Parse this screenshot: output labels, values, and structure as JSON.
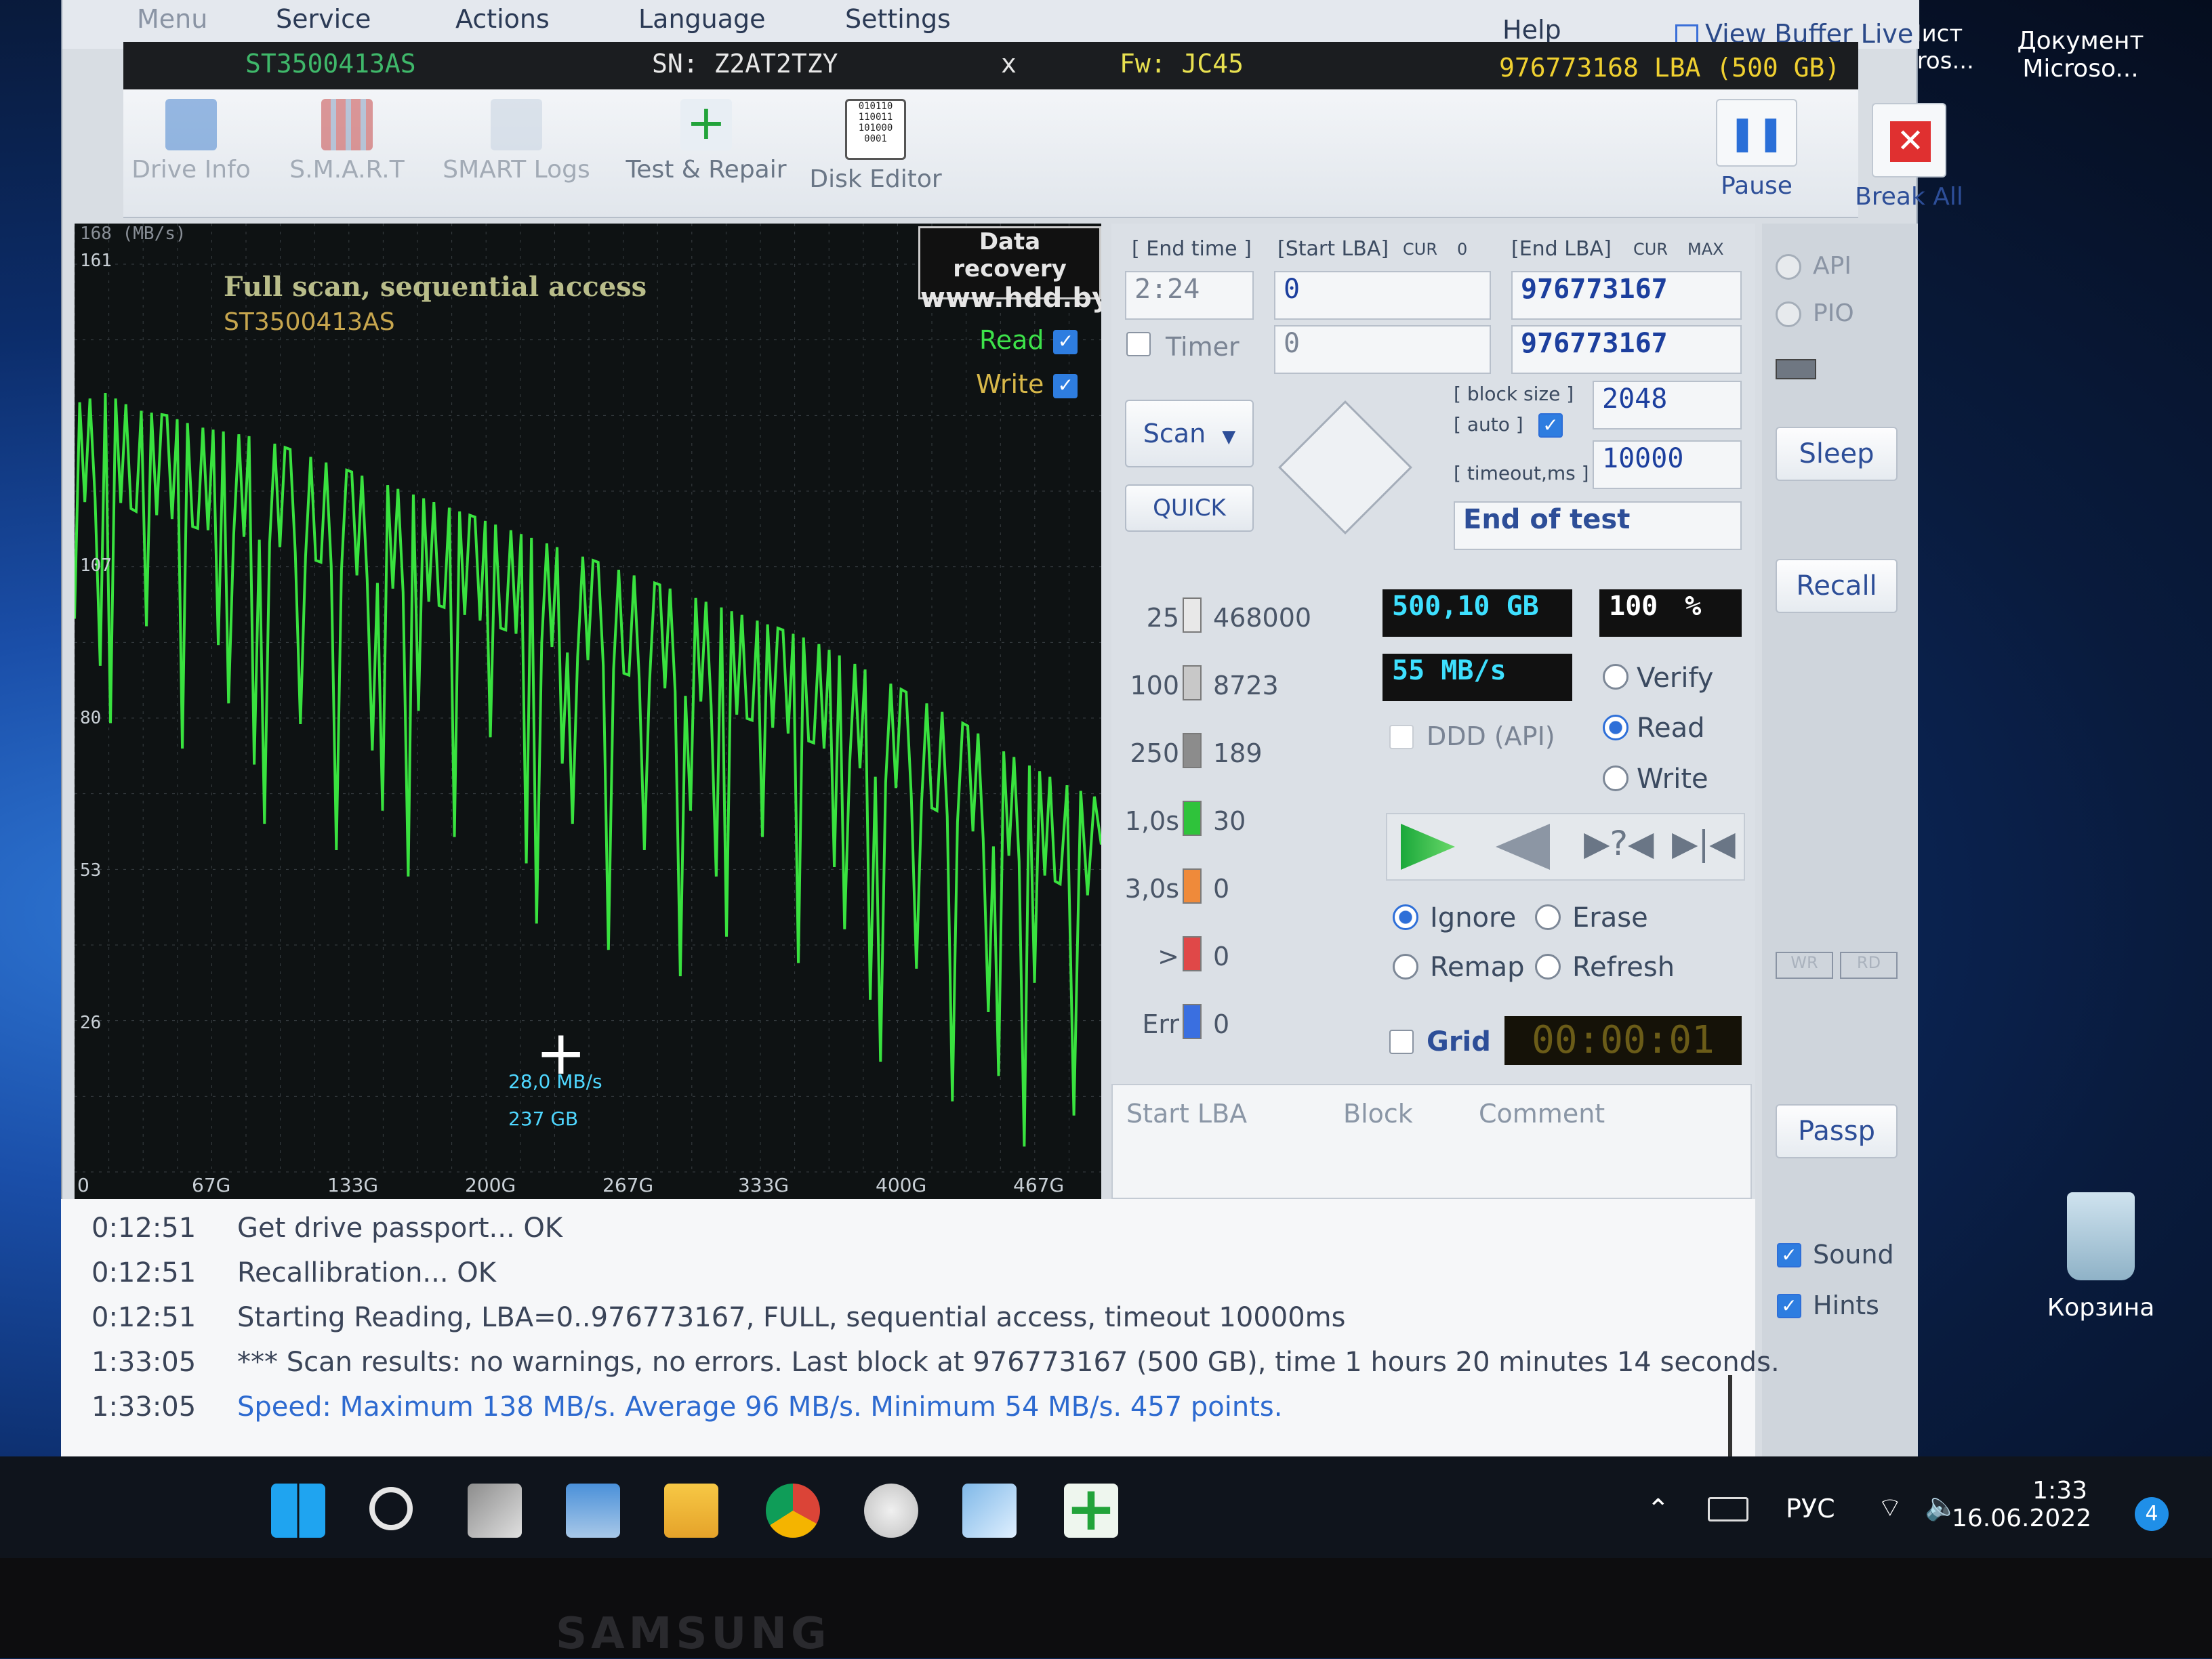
{
  "menu": {
    "items": [
      "Menu",
      "Service",
      "Actions",
      "Language",
      "Settings",
      "Help"
    ],
    "view_buffer": "View Buffer Live"
  },
  "drive": {
    "model": "ST3500413AS",
    "serial": "SN: Z2AT2TZY",
    "close": "x",
    "firmware": "Fw: JC45",
    "capacity": "976773168 LBA (500 GB)"
  },
  "toolbar": {
    "items": [
      "Drive Info",
      "S.M.A.R.T",
      "SMART Logs",
      "Test & Repair",
      "Disk Editor"
    ],
    "pause": "Pause",
    "break_all": "Break All"
  },
  "graph": {
    "scale_label": "168 (MB/s)",
    "title": "Full scan, sequential access",
    "model": "ST3500413AS",
    "watermark1": "Data recovery",
    "watermark2": "www.hdd.by",
    "read": "Read",
    "write": "Write",
    "cursor_speed": "28,0 MB/s",
    "cursor_pos": "237 GB"
  },
  "chart_data": {
    "type": "line",
    "xlabel": "",
    "ylabel": "",
    "x_ticks": [
      "0",
      "67G",
      "133G",
      "200G",
      "267G",
      "333G",
      "400G",
      "467G"
    ],
    "y_ticks": [
      "161",
      "107",
      "80",
      "53",
      "26"
    ],
    "ylim": [
      0,
      168
    ],
    "series": [
      {
        "name": "Read",
        "x_gb": [
          0,
          15,
          30,
          45,
          60,
          75,
          90,
          105,
          120,
          135,
          150,
          165,
          180,
          195,
          210,
          225,
          240,
          255,
          270,
          285,
          300,
          315,
          330,
          345,
          360,
          375,
          390,
          405,
          420,
          435,
          450,
          465,
          480,
          500
        ],
        "values": [
          128,
          130,
          127,
          126,
          124,
          123,
          122,
          120,
          118,
          116,
          114,
          112,
          110,
          108,
          106,
          104,
          102,
          100,
          98,
          96,
          94,
          92,
          90,
          88,
          86,
          83,
          80,
          77,
          74,
          71,
          67,
          64,
          61,
          58
        ]
      }
    ]
  },
  "controls": {
    "end_time_label": "[ End time ]",
    "start_lba_label": "[Start LBA]",
    "cur": "CUR",
    "zero": "0",
    "end_lba_label": "[End LBA]",
    "max": "MAX",
    "end_time": "2:24",
    "start_lba": "0",
    "end_lba": "976773167",
    "timer_label": "Timer",
    "timer_value": "0",
    "end_lba2": "976773167",
    "block_size_label": "[ block size ]",
    "auto_label": "[ auto ]",
    "block_size": "2048",
    "timeout_label": "[ timeout,ms ]",
    "timeout": "10000",
    "scan": "Scan",
    "quick": "QUICK",
    "end_of_test": "End of test"
  },
  "stats": {
    "rows": [
      {
        "label": "25",
        "count": "468000",
        "color": "#e8e8e8"
      },
      {
        "label": "100",
        "count": "8723",
        "color": "#c8c8c8"
      },
      {
        "label": "250",
        "count": "189",
        "color": "#8c8c8c"
      },
      {
        "label": "1,0s",
        "count": "30",
        "color": "#2fc33b"
      },
      {
        "label": "3,0s",
        "count": "0",
        "color": "#ef8a3a"
      },
      {
        "label": ">",
        "count": "0",
        "color": "#e04848"
      },
      {
        "label": "Err",
        "count": "0",
        "color": "#3a6fe0"
      }
    ],
    "size": "500,10 GB",
    "percent": "100",
    "percent_sign": "%",
    "speed": "55 MB/s",
    "ddd": "DDD (API)",
    "verify": "Verify",
    "read": "Read",
    "write": "Write",
    "ignore": "Ignore",
    "erase": "Erase",
    "remap": "Remap",
    "refresh": "Refresh",
    "grid": "Grid",
    "timer": "00:00:01"
  },
  "table": {
    "headers": [
      "Start LBA",
      "Block",
      "Comment"
    ]
  },
  "side": {
    "api": "API",
    "pio": "PIO",
    "sleep": "Sleep",
    "recall": "Recall",
    "wr": "WR",
    "rd": "RD",
    "passp": "Passp",
    "sound": "Sound",
    "hints": "Hints"
  },
  "log": [
    {
      "t": "0:12:51",
      "m": "Get drive passport... OK"
    },
    {
      "t": "0:12:51",
      "m": "Recallibration... OK"
    },
    {
      "t": "0:12:51",
      "m": "Starting Reading, LBA=0..976773167, FULL, sequential access, timeout 10000ms"
    },
    {
      "t": "1:33:05",
      "m": "*** Scan results: no warnings, no errors. Last block at 976773167 (500 GB), time 1 hours 20 minutes 14 seconds."
    },
    {
      "t": "1:33:05",
      "m": "Speed: Maximum 138 MB/s. Average 96 MB/s. Minimum 54 MB/s. 457 points."
    }
  ],
  "desktop": {
    "icon1": "Лист",
    "icon1b": "cros...",
    "icon2": "Документ",
    "icon2b": "Microso...",
    "recycle": "Корзина"
  },
  "taskbar": {
    "lang": "РУС",
    "time": "1:33",
    "date": "16.06.2022",
    "badge": "4"
  },
  "bezel": "SAMSUNG"
}
